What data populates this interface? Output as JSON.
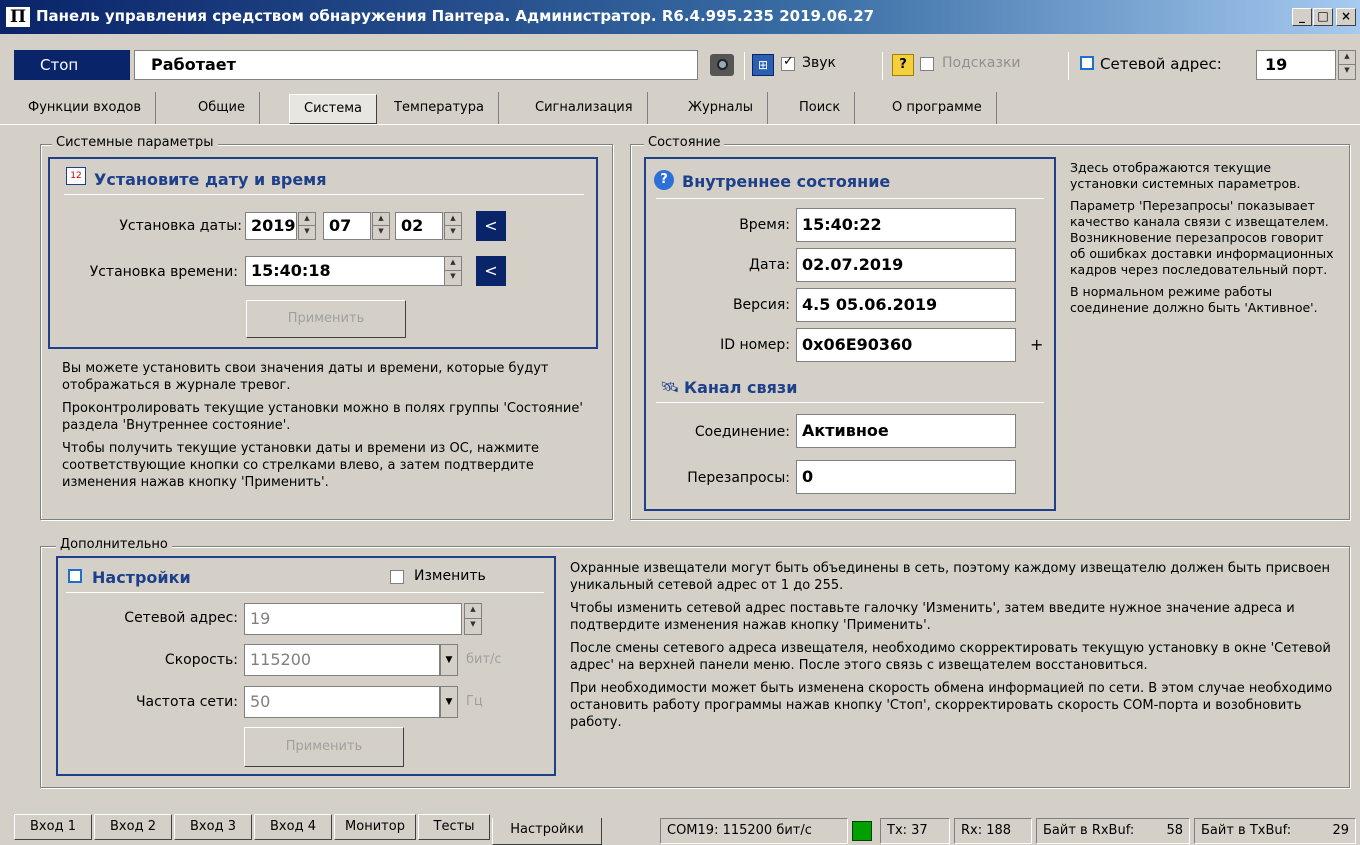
{
  "window": {
    "title": "Панель управления средством обнаружения Пантера. Администратор. R6.4.995.235 2019.06.27"
  },
  "toolbar": {
    "stop_label": "Стоп",
    "status_value": "Работает",
    "sound_label": "Звук",
    "sound_checked": true,
    "hints_label": "Подсказки",
    "hints_checked": false,
    "net_address_label": "Сетевой адрес:",
    "net_address_value": "19"
  },
  "tabs": [
    {
      "label": "Функции входов"
    },
    {
      "label": "Общие"
    },
    {
      "label": "Система",
      "active": true
    },
    {
      "label": "Температура"
    },
    {
      "label": "Сигнализация"
    },
    {
      "label": "Журналы"
    },
    {
      "label": "Поиск"
    },
    {
      "label": "О программе"
    }
  ],
  "system_params": {
    "group_title": "Системные параметры",
    "panel_title": "Установите дату и время",
    "date_label": "Установка даты:",
    "date_year": "2019",
    "date_month": "07",
    "date_day": "02",
    "time_label": "Установка времени:",
    "time_value": "15:40:18",
    "nav_symbol": "<",
    "apply_label": "Применить",
    "help": [
      "Вы можете установить свои значения даты и времени, которые будут отображаться в журнале тревог.",
      "Проконтролировать текущие установки можно в полях группы 'Состояние' раздела 'Внутреннее состояние'.",
      "Чтобы получить текущие установки даты и времени из ОС, нажмите соответствующие кнопки со стрелками влево, а затем подтвердите изменения нажав кнопку 'Применить'."
    ]
  },
  "state": {
    "group_title": "Состояние",
    "internal_title": "Внутреннее состояние",
    "time_label": "Время:",
    "time_value": "15:40:22",
    "date_label": "Дата:",
    "date_value": "02.07.2019",
    "version_label": "Версия:",
    "version_value": "4.5 05.06.2019",
    "id_label": "ID номер:",
    "id_value": "0x06E90360",
    "plus_symbol": "+",
    "channel_title": "Канал связи",
    "connection_label": "Соединение:",
    "connection_value": "Активное",
    "retries_label": "Перезапросы:",
    "retries_value": "0",
    "help": [
      "Здесь отображаются текущие установки системных параметров.",
      "Параметр 'Перезапросы' показывает качество канала связи с извещателем. Возникновение перезапросов говорит об ошибках доставки информационных кадров через последовательный порт.",
      "В нормальном режиме работы соединение должно быть 'Активное'."
    ]
  },
  "additional": {
    "group_title": "Дополнительно",
    "panel_title": "Настройки",
    "change_label": "Изменить",
    "change_checked": false,
    "net_addr_label": "Сетевой адрес:",
    "net_addr_value": "19",
    "speed_label": "Скорость:",
    "speed_value": "115200",
    "speed_unit": "бит/с",
    "freq_label": "Частота сети:",
    "freq_value": "50",
    "freq_unit": "Гц",
    "apply_label": "Применить",
    "help": [
      "Охранные извещатели могут быть объединены в сеть, поэтому каждому извещателю должен быть присвоен уникальный сетевой адрес от 1 до 255.",
      "Чтобы изменить сетевой адрес поставьте галочку 'Изменить', затем введите нужное значение адреса и подтвердите изменения нажав кнопку 'Применить'.",
      "После смены сетевого адреса извещателя, необходимо скорректировать текущую установку в окне 'Сетевой адрес' на верхней панели меню. После этого связь с извещателем восстановиться.",
      "При необходимости может быть изменена скорость обмена информацией по сети. В этом случае необходимо остановить работу программы нажав кнопку 'Стоп', скорректировать скорость COM-порта и возобновить работу."
    ]
  },
  "bottom_tabs": [
    {
      "label": "Вход 1"
    },
    {
      "label": "Вход 2"
    },
    {
      "label": "Вход 3"
    },
    {
      "label": "Вход 4"
    },
    {
      "label": "Монитор"
    },
    {
      "label": "Тесты"
    },
    {
      "label": "Настройки",
      "active": true
    }
  ],
  "statusbar": {
    "port": "COM19: 115200 бит/с",
    "indicator_color": "#00a000",
    "tx": "Tx: 37",
    "rx": "Rx: 188",
    "rxbuf_label": "Байт в RxBuf:",
    "rxbuf_value": "58",
    "txbuf_label": "Байт в TxBuf:",
    "txbuf_value": "29"
  },
  "colors": {
    "accent": "#0a246a",
    "panel_border": "#1e3f8a",
    "background": "#d4d0c8"
  }
}
